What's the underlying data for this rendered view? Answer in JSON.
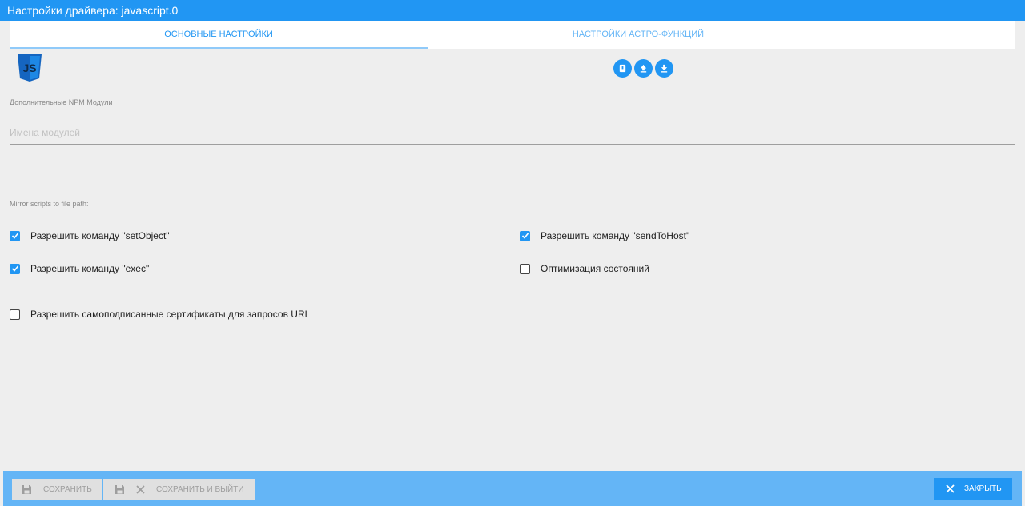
{
  "window": {
    "title": "Настройки драйвера: javascript.0"
  },
  "tabs": [
    {
      "label": "Основные настройки",
      "active": true
    },
    {
      "label": "Настройки астро-функций",
      "active": false
    }
  ],
  "logo": {
    "text": "JS"
  },
  "icon_buttons": [
    {
      "icon": "book-icon"
    },
    {
      "icon": "upload-icon"
    },
    {
      "icon": "download-icon"
    }
  ],
  "npm": {
    "label": "Дополнительные NPM Модули",
    "placeholder": "Имена модулей",
    "value": ""
  },
  "mirror": {
    "label": "Mirror scripts to file path:",
    "value": ""
  },
  "checkboxes": {
    "set_object": {
      "label": "Разрешить команду \"setObject\"",
      "checked": true
    },
    "exec": {
      "label": "Разрешить команду \"exec\"",
      "checked": true
    },
    "self_signed": {
      "label": "Разрешить самоподписанные сертификаты для запросов URL",
      "checked": false
    },
    "send_to_host": {
      "label": "Разрешить команду \"sendToHost\"",
      "checked": true
    },
    "optimization": {
      "label": "Оптимизация состояний",
      "checked": false
    }
  },
  "footer": {
    "save_label": "Сохранить",
    "save_exit_label": "Сохранить и выйти",
    "close_label": "Закрыть"
  },
  "colors": {
    "primary": "#2196f3",
    "footer": "#64b5f6",
    "background": "#eeeeee"
  }
}
